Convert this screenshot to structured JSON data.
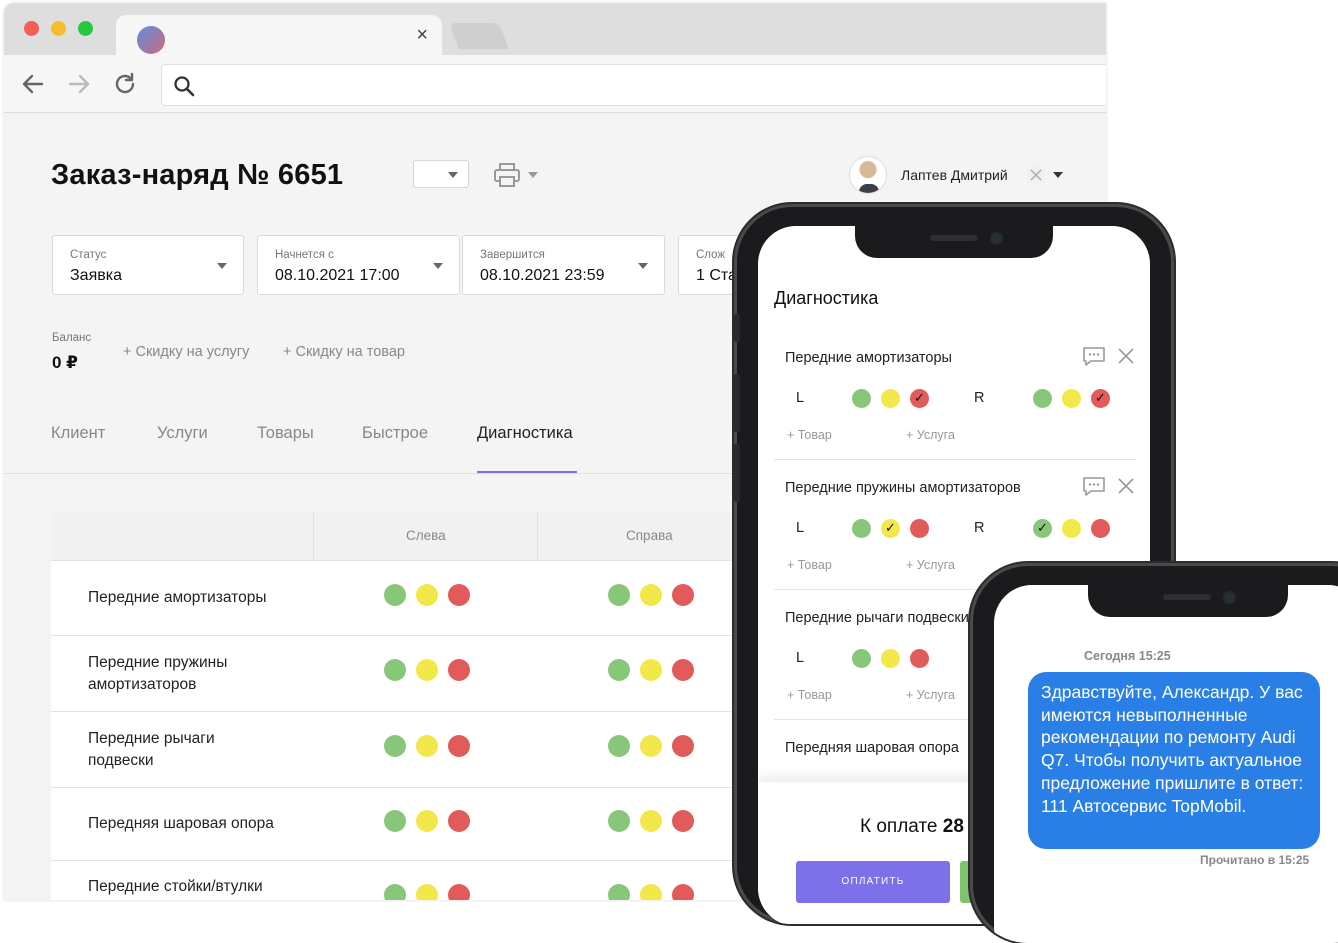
{
  "browser": {
    "tab_close_glyph": "×"
  },
  "order": {
    "title": "Заказ-наряд № 6651",
    "user_name": "Лаптев Дмитрий"
  },
  "fields": [
    {
      "label": "Статус",
      "value": "Заявка"
    },
    {
      "label": "Начнется с",
      "value": "08.10.2021 17:00"
    },
    {
      "label": "Завершится",
      "value": "08.10.2021 23:59"
    },
    {
      "label": "Слож",
      "value": "1 Ста"
    }
  ],
  "balance": {
    "label": "Баланс",
    "value": "0 ₽"
  },
  "discounts": {
    "service": "+ Скидку на услугу",
    "product": "+ Скидку на товар"
  },
  "tabs": [
    {
      "label": "Клиент"
    },
    {
      "label": "Услуги"
    },
    {
      "label": "Товары"
    },
    {
      "label": "Быстрое"
    },
    {
      "label": "Диагностика",
      "active": true
    }
  ],
  "table": {
    "headers": {
      "left": "Слева",
      "right": "Справа"
    },
    "rows": [
      {
        "name": "Передние амортизаторы"
      },
      {
        "name": "Передние пружины амортизаторов"
      },
      {
        "name": "Передние рычаги подвески"
      },
      {
        "name": "Передняя шаровая опора"
      },
      {
        "name": "Передние стойки/втулки"
      }
    ]
  },
  "phone_app": {
    "title": "Диагностика",
    "side_left": "L",
    "side_right": "R",
    "add_product": "+ Товар",
    "add_service": "+ Услуга",
    "items": [
      {
        "name": "Передние амортизаторы",
        "left_checked": "red",
        "right_checked": "red"
      },
      {
        "name": "Передние пружины амортизаторов",
        "left_checked": "yellow",
        "right_checked": "green"
      },
      {
        "name": "Передние рычаги подвески",
        "left_checked": "none"
      },
      {
        "name": "Передняя шаровая опора"
      }
    ],
    "pay_label": "К оплате",
    "pay_amount": "28",
    "pay_button": "ОПЛАТИТЬ"
  },
  "sms": {
    "date": "Сегодня 15:25",
    "message": "Здравствуйте, Александр. У вас имеются невыполненные рекомендации по ремонту Audi Q7. Чтобы получить актуальное предложение пришлите в ответ: 111 Автосервис TopMobil.",
    "read_status": "Прочитано в 15:25"
  },
  "colors": {
    "green": "#88c77a",
    "yellow": "#f2e84a",
    "red": "#e15b5b",
    "accent": "#7c6ef0",
    "sms_bubble": "#2a7fe6"
  },
  "icons": [
    "back-arrow-icon",
    "forward-arrow-icon",
    "reload-icon",
    "search-icon",
    "printer-icon",
    "chevron-down-icon",
    "close-icon",
    "comment-icon",
    "check-icon"
  ]
}
